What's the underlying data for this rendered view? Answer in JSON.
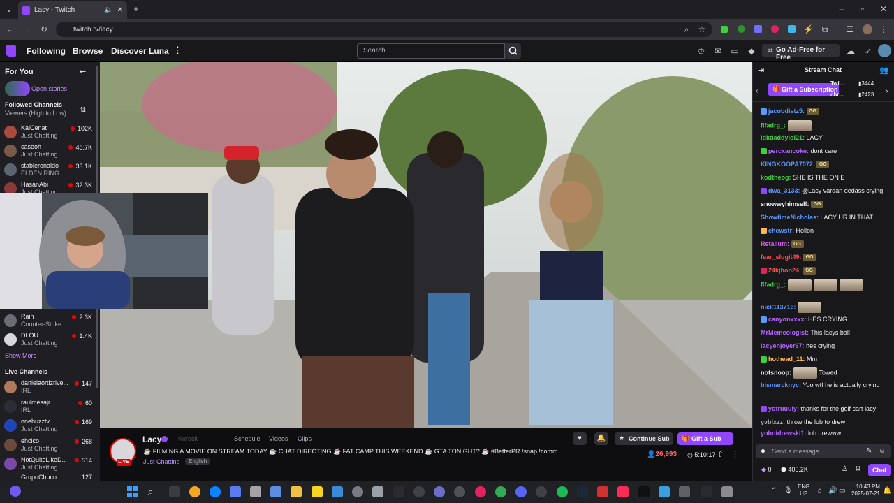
{
  "browser": {
    "tab_title": "Lacy - Twitch",
    "url": "twitch.tv/lacy"
  },
  "nav": {
    "following": "Following",
    "browse": "Browse",
    "discover": "Discover Luna",
    "search_placeholder": "Search",
    "ad_free": "Go Ad-Free for Free"
  },
  "sidebar": {
    "for_you": "For You",
    "open_stories": "Open stories",
    "followed_title": "Followed Channels",
    "followed_sort": "Viewers (High to Low)",
    "followed": [
      {
        "name": "KaiCenat",
        "game": "Just Chatting",
        "viewers": "102K"
      },
      {
        "name": "caseoh_",
        "game": "Just Chatting",
        "viewers": "48.7K"
      },
      {
        "name": "stableronaldo",
        "game": "ELDEN RING",
        "viewers": "33.1K"
      },
      {
        "name": "HasanAbi",
        "game": "Just Chatting",
        "viewers": "32.3K"
      }
    ],
    "followed_lower": [
      {
        "name": "Rain",
        "game": "Counter-Strike",
        "viewers": "2.3K"
      },
      {
        "name": "DLOU",
        "game": "Just Chatting",
        "viewers": "1.4K"
      }
    ],
    "show_more": "Show More",
    "live_title": "Live Channels",
    "live": [
      {
        "name": "danielaortizrive...",
        "game": "IRL",
        "viewers": "147"
      },
      {
        "name": "raulmesajr",
        "game": "IRL",
        "viewers": "60"
      },
      {
        "name": "onebuzztv",
        "game": "Just Chatting",
        "viewers": "169"
      },
      {
        "name": "ehcico",
        "game": "Just Chatting",
        "viewers": "268"
      },
      {
        "name": "NotQuiteLikeD...",
        "game": "Just Chatting",
        "viewers": "514"
      },
      {
        "name": "GrupoChuco",
        "game": "",
        "viewers": "127"
      }
    ]
  },
  "stream": {
    "streamer": "Lacy",
    "team": "Kurock",
    "schedule": "Schedule",
    "videos": "Videos",
    "clips": "Clips",
    "title": "☕ FILMING A MOVIE ON STREAM TODAY ☕ CHAT DIRECTING ☕ FAT CAMP THIS WEEKEND ☕ GTA TONIGHT? ☕ #BetterPR !snap !comm",
    "category": "Just Chatting",
    "language": "English",
    "live_badge": "LIVE",
    "viewers": "26,993",
    "uptime": "5:10:17",
    "continue_sub": "Continue Sub",
    "gift_sub": "Gift a Sub"
  },
  "chat": {
    "title": "Stream Chat",
    "gift_banner": "Gift a Subscription",
    "gifters": [
      {
        "name": "Twi...",
        "count": "3444"
      },
      {
        "name": "chr...",
        "count": "2423"
      }
    ],
    "messages": [
      {
        "user": "jacobdietz5:",
        "color": "#5b9bff",
        "text": "",
        "gg": true
      },
      {
        "user": "fifadrg_:",
        "color": "#3ed13e",
        "text": "",
        "emote": 1
      },
      {
        "user": "idkdaddylol21:",
        "color": "#3ed13e",
        "text": "LACY"
      },
      {
        "user": "percxancoke:",
        "color": "#b566ff",
        "text": "dont care"
      },
      {
        "user": "KINGKOOPA7072:",
        "color": "#5b9bff",
        "text": "",
        "gg": true
      },
      {
        "user": "kodtheog:",
        "color": "#3ed13e",
        "text": "SHE IS THE ON E"
      },
      {
        "user": "dwa_3133:",
        "color": "#5b9bff",
        "text": "@Lacy vardan dedass crying"
      },
      {
        "user": "snowwyhimself:",
        "color": "#efeff1",
        "text": "",
        "gg": true
      },
      {
        "user": "ShowtimeNicholas:",
        "color": "#5b9bff",
        "text": "LACY UR IN THAT"
      },
      {
        "user": "ehewstr:",
        "color": "#5b9bff",
        "text": "Hollon"
      },
      {
        "user": "Retalium:",
        "color": "#e05bff",
        "text": "",
        "gg": true
      },
      {
        "user": "fear_slugit49:",
        "color": "#ff4f4f",
        "text": "",
        "gg": true
      },
      {
        "user": "24kjhon24:",
        "color": "#ff4f4f",
        "text": "",
        "gg": true
      },
      {
        "user": "fifadrg_:",
        "color": "#3ed13e",
        "text": "",
        "emote": 3
      },
      {
        "user": "nick113716:",
        "color": "#5b9bff",
        "text": "",
        "emote": 1
      },
      {
        "user": "canyonxxxx:",
        "color": "#b566ff",
        "text": "HES CRYING"
      },
      {
        "user": "MrMemeologist:",
        "color": "#b566ff",
        "text": "This lacys ball"
      },
      {
        "user": "lacyenjoyer67:",
        "color": "#b566ff",
        "text": "hes crying"
      },
      {
        "user": "hothead_11:",
        "color": "#ffb84f",
        "text": "Mm"
      },
      {
        "user": "notsnoop:",
        "color": "#efeff1",
        "text": "Towed",
        "emote": 1
      },
      {
        "user": "bismarcknyc:",
        "color": "#5b9bff",
        "text": "Yoo wtf he is actually crying"
      },
      {
        "user": "yotruuuly:",
        "color": "#b566ff",
        "text": "thanks for the golf cart lacy"
      },
      {
        "user": "yvblxzz:",
        "color": "#adadb8",
        "text": "throw the lob to drew"
      },
      {
        "user": "yoboidrewski1:",
        "color": "#b566ff",
        "text": "lob drewww"
      }
    ],
    "input_placeholder": "Send a message",
    "points": "0",
    "bits": "405.2K",
    "chat_button": "Chat"
  },
  "taskbar": {
    "lang": "ENG",
    "region": "US",
    "time": "10:43 PM",
    "date": "2025-07-21"
  },
  "colors": {
    "twitch_purple": "#9147ff",
    "live_red": "#eb0400",
    "bg_dark": "#0e0e10"
  }
}
